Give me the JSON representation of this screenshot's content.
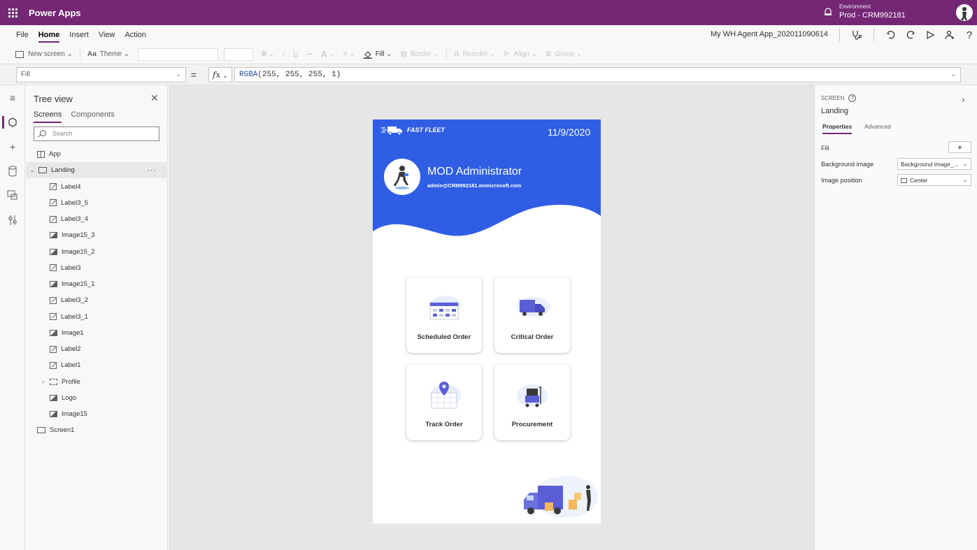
{
  "app": {
    "title": "Power Apps",
    "environment_label": "Environment",
    "environment_value": "Prod - CRM992181"
  },
  "menu": {
    "items": [
      "File",
      "Home",
      "Insert",
      "View",
      "Action"
    ],
    "active": "Home",
    "app_name": "My WH Agent App_202011090614"
  },
  "toolbar": {
    "new_screen": "New screen",
    "theme": "Theme",
    "fill": "Fill",
    "border": "Border",
    "reorder": "Reorder",
    "align": "Align",
    "group": "Group"
  },
  "formula_bar": {
    "property": "Fill",
    "equals": "=",
    "fx": "fx",
    "formula_fn": "RGBA",
    "formula_args": "(255, 255, 255, 1)"
  },
  "tree_view": {
    "title": "Tree view",
    "tabs": [
      "Screens",
      "Components"
    ],
    "active_tab": "Screens",
    "search_placeholder": "Search",
    "items": [
      {
        "label": "App",
        "type": "app",
        "indent": 0
      },
      {
        "label": "Landing",
        "type": "screen",
        "indent": 0,
        "expanded": true,
        "selected": true
      },
      {
        "label": "Label4",
        "type": "label",
        "indent": 1
      },
      {
        "label": "Label3_5",
        "type": "label",
        "indent": 1
      },
      {
        "label": "Label3_4",
        "type": "label",
        "indent": 1
      },
      {
        "label": "Image15_3",
        "type": "image",
        "indent": 1
      },
      {
        "label": "Image15_2",
        "type": "image",
        "indent": 1
      },
      {
        "label": "Label3",
        "type": "label",
        "indent": 1
      },
      {
        "label": "Image15_1",
        "type": "image",
        "indent": 1
      },
      {
        "label": "Label3_2",
        "type": "label",
        "indent": 1
      },
      {
        "label": "Label3_1",
        "type": "label",
        "indent": 1
      },
      {
        "label": "Image1",
        "type": "image",
        "indent": 1
      },
      {
        "label": "Label2",
        "type": "label",
        "indent": 1
      },
      {
        "label": "Label1",
        "type": "label",
        "indent": 1
      },
      {
        "label": "Profile",
        "type": "group",
        "indent": 1,
        "collapsed": true
      },
      {
        "label": "Logo",
        "type": "image",
        "indent": 1
      },
      {
        "label": "Image15",
        "type": "image",
        "indent": 1
      },
      {
        "label": "Screen1",
        "type": "screen",
        "indent": 0
      }
    ]
  },
  "canvas": {
    "brand": "FAST FLEET",
    "date": "11/9/2020",
    "user_name": "MOD Administrator",
    "user_email": "admin@CRM992181.onmicrosoft.com",
    "header_color": "#2f5ee5",
    "accent_color": "#5a5fd6",
    "cards": [
      {
        "label": "Scheduled Order",
        "icon": "calendar-icon"
      },
      {
        "label": "Critical Order",
        "icon": "truck-icon"
      },
      {
        "label": "Track Order",
        "icon": "map-pin-icon"
      },
      {
        "label": "Procurement",
        "icon": "cart-icon"
      }
    ]
  },
  "properties": {
    "kind": "SCREEN",
    "name": "Landing",
    "tabs": [
      "Properties",
      "Advanced"
    ],
    "active_tab": "Properties",
    "fill_label": "Fill",
    "bg_image_label": "Background image",
    "bg_image_value": "Background image_...",
    "image_position_label": "Image position",
    "image_position_value": "Center"
  },
  "colors": {
    "brand_purple": "#742774"
  }
}
